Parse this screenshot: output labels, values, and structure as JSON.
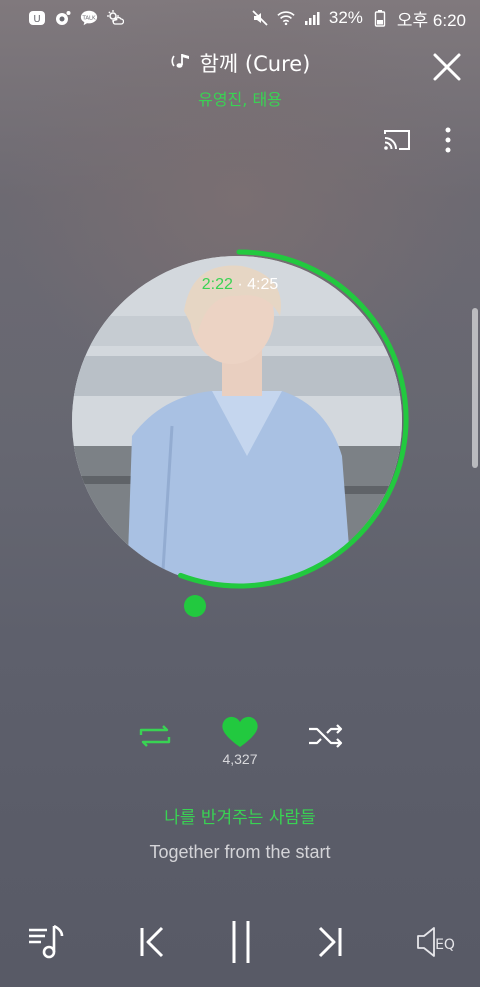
{
  "status_bar": {
    "battery_percent": "32%",
    "time": "오후 6:20",
    "left_icons": [
      "melon-icon",
      "kakao-icon",
      "kakaotalk-icon",
      "weather-icon"
    ],
    "right_icons": [
      "mute-icon",
      "wifi-icon",
      "signal-icon",
      "battery-icon"
    ]
  },
  "header": {
    "song_title": "함께 (Cure)",
    "artist": "유영진, 태용"
  },
  "player": {
    "current_time": "2:22",
    "separator": "·",
    "total_time": "4:25",
    "progress": 0.557,
    "like_count": "4,327"
  },
  "lyrics": {
    "current": "나를 반겨주는 사람들",
    "next": "Together from the start"
  },
  "colors": {
    "accent": "#39d353",
    "progress": "#22c93f"
  }
}
